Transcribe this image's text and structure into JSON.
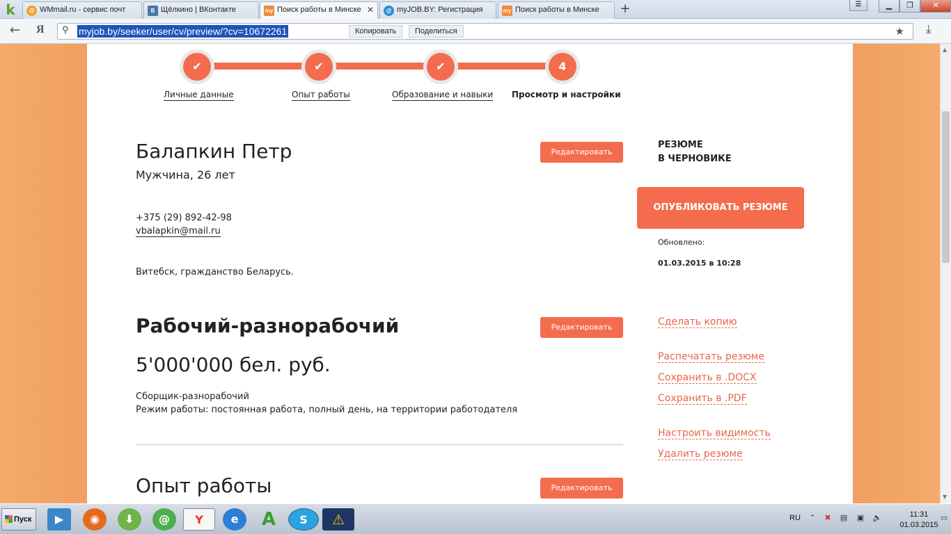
{
  "browser": {
    "tabs": [
      {
        "label": "WMmail.ru - сервис почт",
        "icon": "wmmail-icon",
        "icon_color": "#f0a030",
        "icon_text": "@"
      },
      {
        "label": "Щёлкино | ВКонтакте",
        "icon": "vk-icon",
        "icon_color": "#4a76a8",
        "icon_text": "В"
      },
      {
        "label": "Поиск работы в Минске",
        "icon": "myjob-icon",
        "icon_color": "#f08a3a",
        "icon_text": "my",
        "active": true
      },
      {
        "label": "myJOB.BY: Регистрация",
        "icon": "myjob-round-icon",
        "icon_color": "#2a8fd0",
        "icon_text": "@"
      },
      {
        "label": "Поиск работы в Минске",
        "icon": "myjob-icon",
        "icon_color": "#f08a3a",
        "icon_text": "my"
      }
    ],
    "url": "myjob.by/seeker/user/cv/preview/?cv=10672261",
    "copy_label": "Копировать",
    "share_label": "Поделиться",
    "ya_label": "Я",
    "logo": "k"
  },
  "steps": [
    {
      "label": "Личные данные",
      "state": "done"
    },
    {
      "label": "Опыт работы",
      "state": "done"
    },
    {
      "label": "Образование и навыки",
      "state": "done"
    },
    {
      "label": "Просмотр и настройки",
      "state": "current",
      "number": "4"
    }
  ],
  "resume": {
    "name": "Балапкин Петр",
    "gender_age": "Мужчина, 26 лет",
    "phone": "+375 (29) 892-42-98",
    "email": "vbalapkin@mail.ru",
    "location": "Витебск, гражданство Беларусь.",
    "position": "Рабочий-разнорабочий",
    "salary": "5'000'000 бел. руб.",
    "specialization": "Сборщик-разнорабочий",
    "work_mode": "Режим работы: постоянная работа, полный день, на территории работодателя",
    "experience_title": "Опыт работы",
    "edit_label": "Редактировать"
  },
  "sidebar": {
    "status_line1": "РЕЗЮМЕ",
    "status_line2": "В ЧЕРНОВИКЕ",
    "publish_label": "ОПУБЛИКОВАТЬ РЕЗЮМЕ",
    "updated_label": "Обновлено:",
    "updated_date": "01.03.2015 в 10:28",
    "links": {
      "copy": "Сделать копию",
      "print": "Распечатать резюме",
      "docx": "Сохранить в .DOCX",
      "pdf": "Сохранить в .PDF",
      "visibility": "Настроить видимость",
      "delete": "Удалить резюме"
    }
  },
  "taskbar": {
    "start_label": "Пуск",
    "lang": "RU",
    "time": "11:31",
    "date": "01.03.2015"
  },
  "colors": {
    "accent": "#f46c4d",
    "link": "#e8654a",
    "page_background": "#efa062"
  }
}
